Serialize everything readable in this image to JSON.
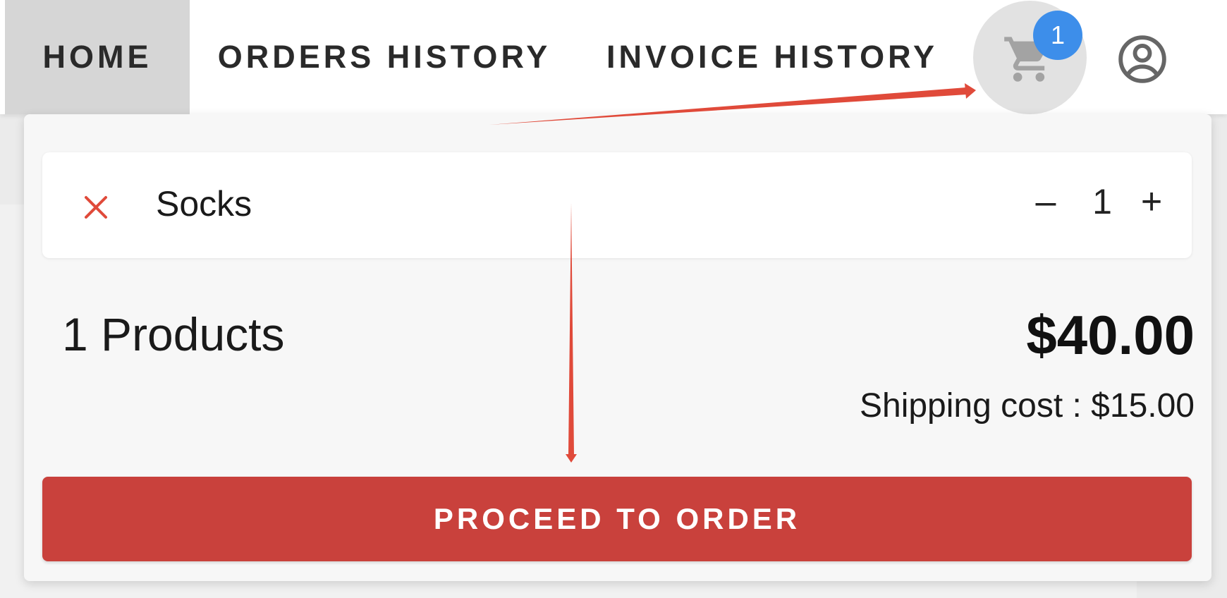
{
  "nav": {
    "tabs": [
      {
        "label": "HOME",
        "active": true
      },
      {
        "label": "ORDERS HISTORY",
        "active": false
      },
      {
        "label": "INVOICE HISTORY",
        "active": false
      }
    ],
    "cart_badge_count": "1",
    "cart_icon": "shopping-cart-icon",
    "account_icon": "account-circle-icon"
  },
  "cart": {
    "items": [
      {
        "name": "Socks",
        "quantity": "1",
        "remove_icon": "close-icon",
        "decrement": "–",
        "increment": "+"
      }
    ],
    "products_count": "1 Products",
    "total": "$40.00",
    "shipping": "Shipping cost : $15.00",
    "proceed_label": "PROCEED TO ORDER"
  },
  "colors": {
    "accent_red": "#c9413c",
    "badge_blue": "#3d8eea",
    "annotation_red": "#e04a3a",
    "active_tab_bg": "#d6d6d6"
  }
}
